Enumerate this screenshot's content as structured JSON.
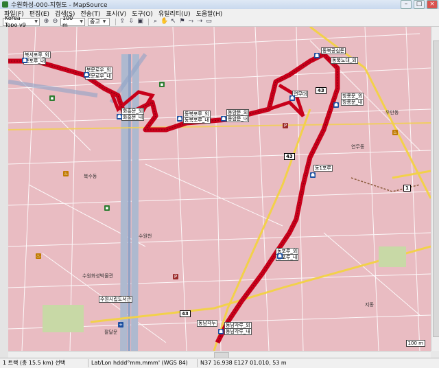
{
  "window": {
    "title": "수원화성-000-지형도 - MapSource"
  },
  "menu": [
    "파일(F)",
    "편집(E)",
    "검색(S)",
    "전송(T)",
    "표시(V)",
    "도구(O)",
    "유틸리티(U)",
    "도움말(H)"
  ],
  "toolbar": {
    "map_product": "Korea Topo v9",
    "zoom_value": "100 m",
    "detail_value": "중고"
  },
  "map": {
    "route_labels": [
      "북문로우_외",
      "북문로우_내",
      "화홍문_외",
      "화홍문_내",
      "동북포루_외",
      "동북포루_내",
      "동암문_외",
      "동암문_내",
      "동북공심돈",
      "동북노대_외",
      "창룡문_외",
      "창룡문_내",
      "연무대",
      "동1포루",
      "동포루_외",
      "동포루_내",
      "동남각루_외",
      "동남각루_내",
      "동남각누",
      "북서포루_외",
      "북포루_내"
    ],
    "road_numbers": [
      "43",
      "43",
      "43",
      "1"
    ],
    "places": [
      "수원시립도서관",
      "수원화성박물관",
      "북수동",
      "수원천",
      "팔달문",
      "지동",
      "우만동",
      "연무동"
    ],
    "scale_label": "100 m"
  },
  "status": {
    "track_info": "1 트랙 (총 15.5 km) 선택",
    "coord_format": "Lat/Lon hddd°mm.mmm' (WGS 84)",
    "coords": "N37 16.938 E127 01.010, 53 m"
  },
  "colors": {
    "map_bg": "#e9bcc2",
    "track": "#c8001a",
    "river": "#8fa3c7",
    "route": "#f2d14a"
  }
}
